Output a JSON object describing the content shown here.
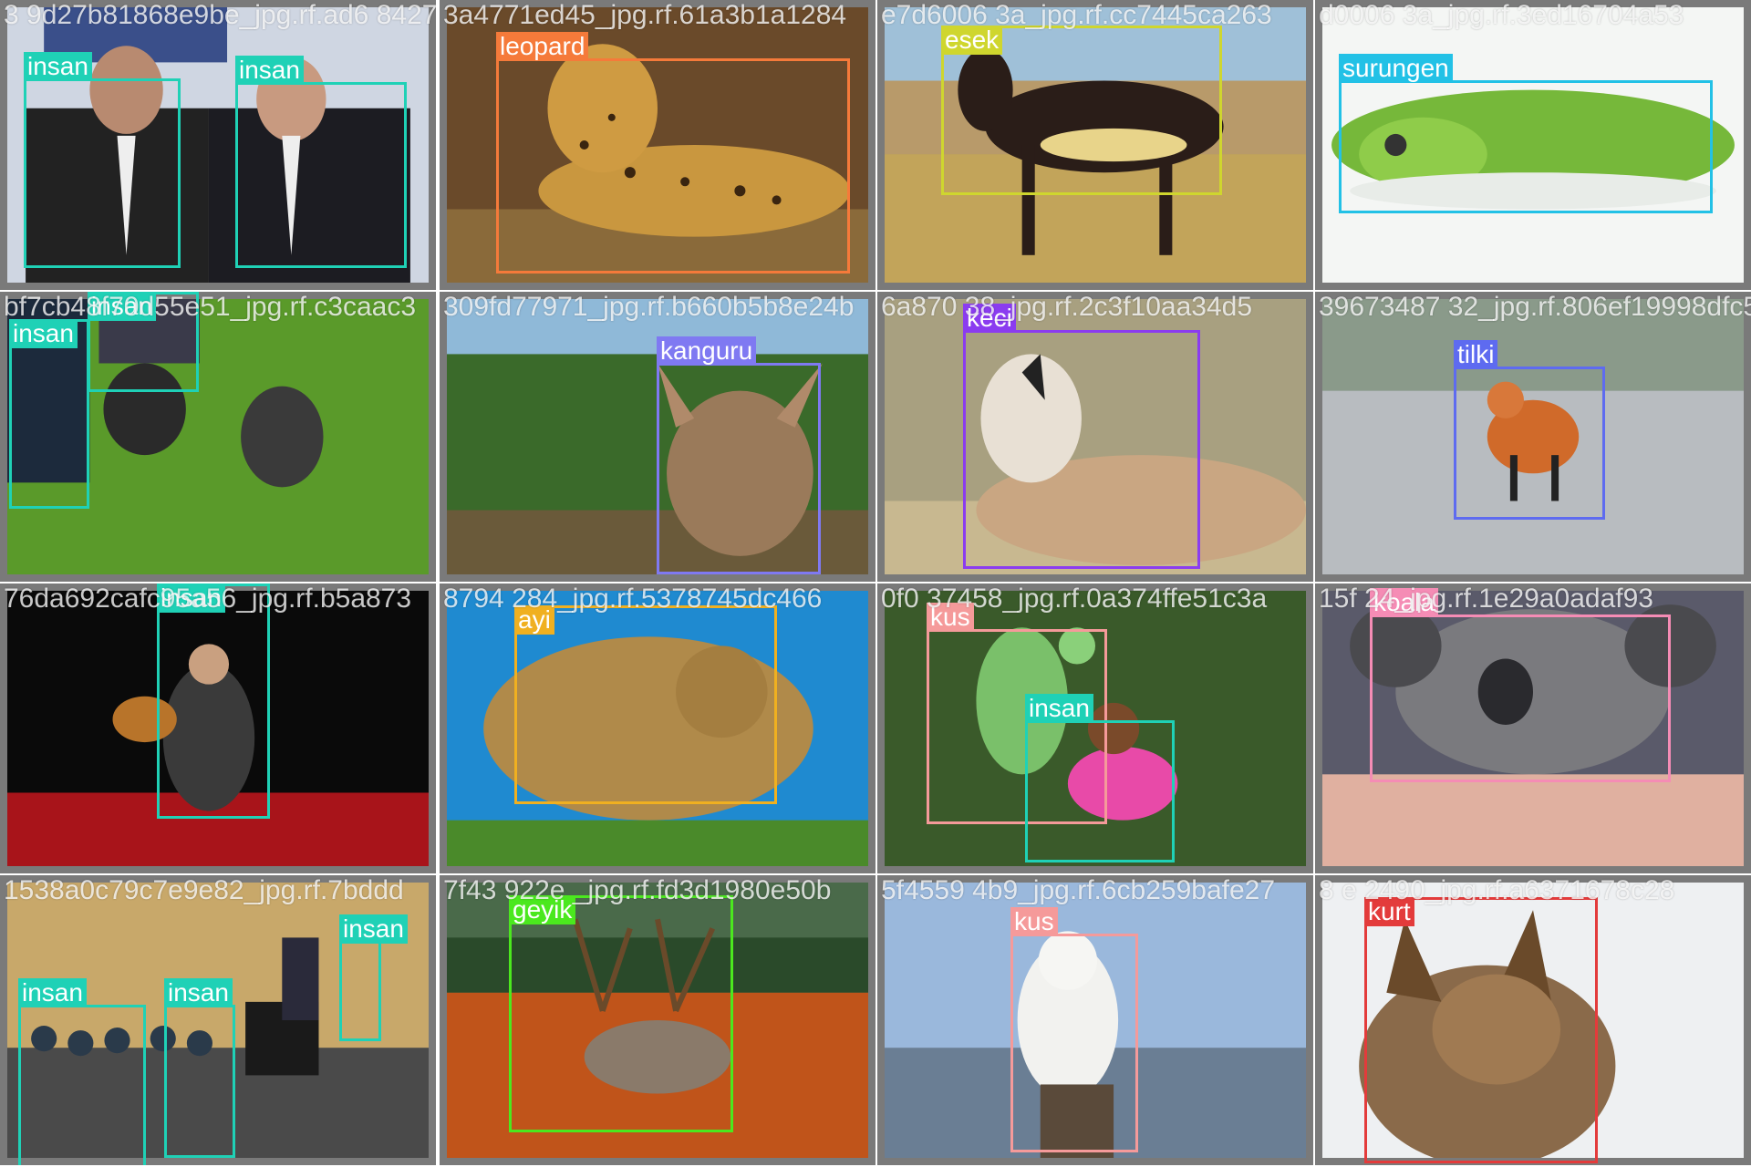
{
  "colors": {
    "insan": "#1fd1b6",
    "leopard": "#f57a3a",
    "esek": "#cfd62e",
    "surungen": "#22c1e6",
    "kanguru": "#7f79f2",
    "keci": "#8b3cf0",
    "tilki": "#5e6bf0",
    "ayi": "#f0b020",
    "kus": "#f59a9a",
    "koala": "#f58cb5",
    "geyik": "#4be81e",
    "kurt": "#e33b3b"
  },
  "tiles": [
    {
      "filename": "3 9d27b81868e9be_jpg.rf.ad6 8427 ",
      "scene": "politicians",
      "boxes": [
        {
          "label": "insan",
          "cls": "insan"
        },
        {
          "label": "insan",
          "cls": "insan"
        }
      ]
    },
    {
      "filename": "3a4771ed45_jpg.rf.61a3b1a1284",
      "scene": "leopard",
      "boxes": [
        {
          "label": "leopard",
          "cls": "leopard"
        }
      ]
    },
    {
      "filename": "e7d6006 3a_jpg.rf.cc7445ca263",
      "scene": "donkey",
      "boxes": [
        {
          "label": "esek",
          "cls": "esek"
        }
      ]
    },
    {
      "filename": "d0006 3a_jpg.rf.3ed16704a53",
      "scene": "lizard",
      "boxes": [
        {
          "label": "surungen",
          "cls": "surungen"
        }
      ]
    },
    {
      "filename": "bf7cb48f70d55e51_jpg.rf.c3caac3",
      "scene": "dogs",
      "boxes": [
        {
          "label": "insan",
          "cls": "insan"
        },
        {
          "label": "insan",
          "cls": "insan"
        }
      ]
    },
    {
      "filename": "309fd77971_jpg.rf.b660b5b8e24b",
      "scene": "kangaroo",
      "boxes": [
        {
          "label": "kanguru",
          "cls": "kanguru"
        }
      ]
    },
    {
      "filename": "6a870 38_jpg.rf.2c3f10aa34d5",
      "scene": "goat",
      "boxes": [
        {
          "label": "keci",
          "cls": "keci"
        }
      ]
    },
    {
      "filename": "39673487 32_jpg.rf.806ef19998dfc5",
      "scene": "fox",
      "boxes": [
        {
          "label": "tilki",
          "cls": "tilki"
        }
      ]
    },
    {
      "filename": "76da692cafc95a56_jpg.rf.b5a873",
      "scene": "guitarist",
      "boxes": [
        {
          "label": "insan",
          "cls": "insan"
        }
      ]
    },
    {
      "filename": "8794 284_jpg.rf.5378745dc466",
      "scene": "bear",
      "boxes": [
        {
          "label": "ayi",
          "cls": "ayi"
        }
      ]
    },
    {
      "filename": "0f0 37458_jpg.rf.0a374ffe51c3a",
      "scene": "parrot",
      "boxes": [
        {
          "label": "kus",
          "cls": "kus"
        },
        {
          "label": "insan",
          "cls": "insan"
        }
      ]
    },
    {
      "filename": "15f 24_jpg.rf.1e29a0adaf93",
      "scene": "koala",
      "boxes": [
        {
          "label": "koala",
          "cls": "koala"
        }
      ]
    },
    {
      "filename": "1538a0c79c7e9e82_jpg.rf.7bddd",
      "scene": "audience",
      "boxes": [
        {
          "label": "insan",
          "cls": "insan"
        },
        {
          "label": "insan",
          "cls": "insan"
        },
        {
          "label": "insan",
          "cls": "insan"
        }
      ]
    },
    {
      "filename": "7f43 922e _jpg.rf.fd3d1980e50b",
      "scene": "reindeer",
      "boxes": [
        {
          "label": "geyik",
          "cls": "geyik"
        }
      ]
    },
    {
      "filename": "5f4559 4b9_jpg.rf.6cb259bafe27",
      "scene": "owl",
      "boxes": [
        {
          "label": "kus",
          "cls": "kus"
        }
      ]
    },
    {
      "filename": "8 e 2490_jpg.rf.a6371678c28",
      "scene": "coyote",
      "boxes": [
        {
          "label": "kurt",
          "cls": "kurt"
        }
      ]
    }
  ]
}
